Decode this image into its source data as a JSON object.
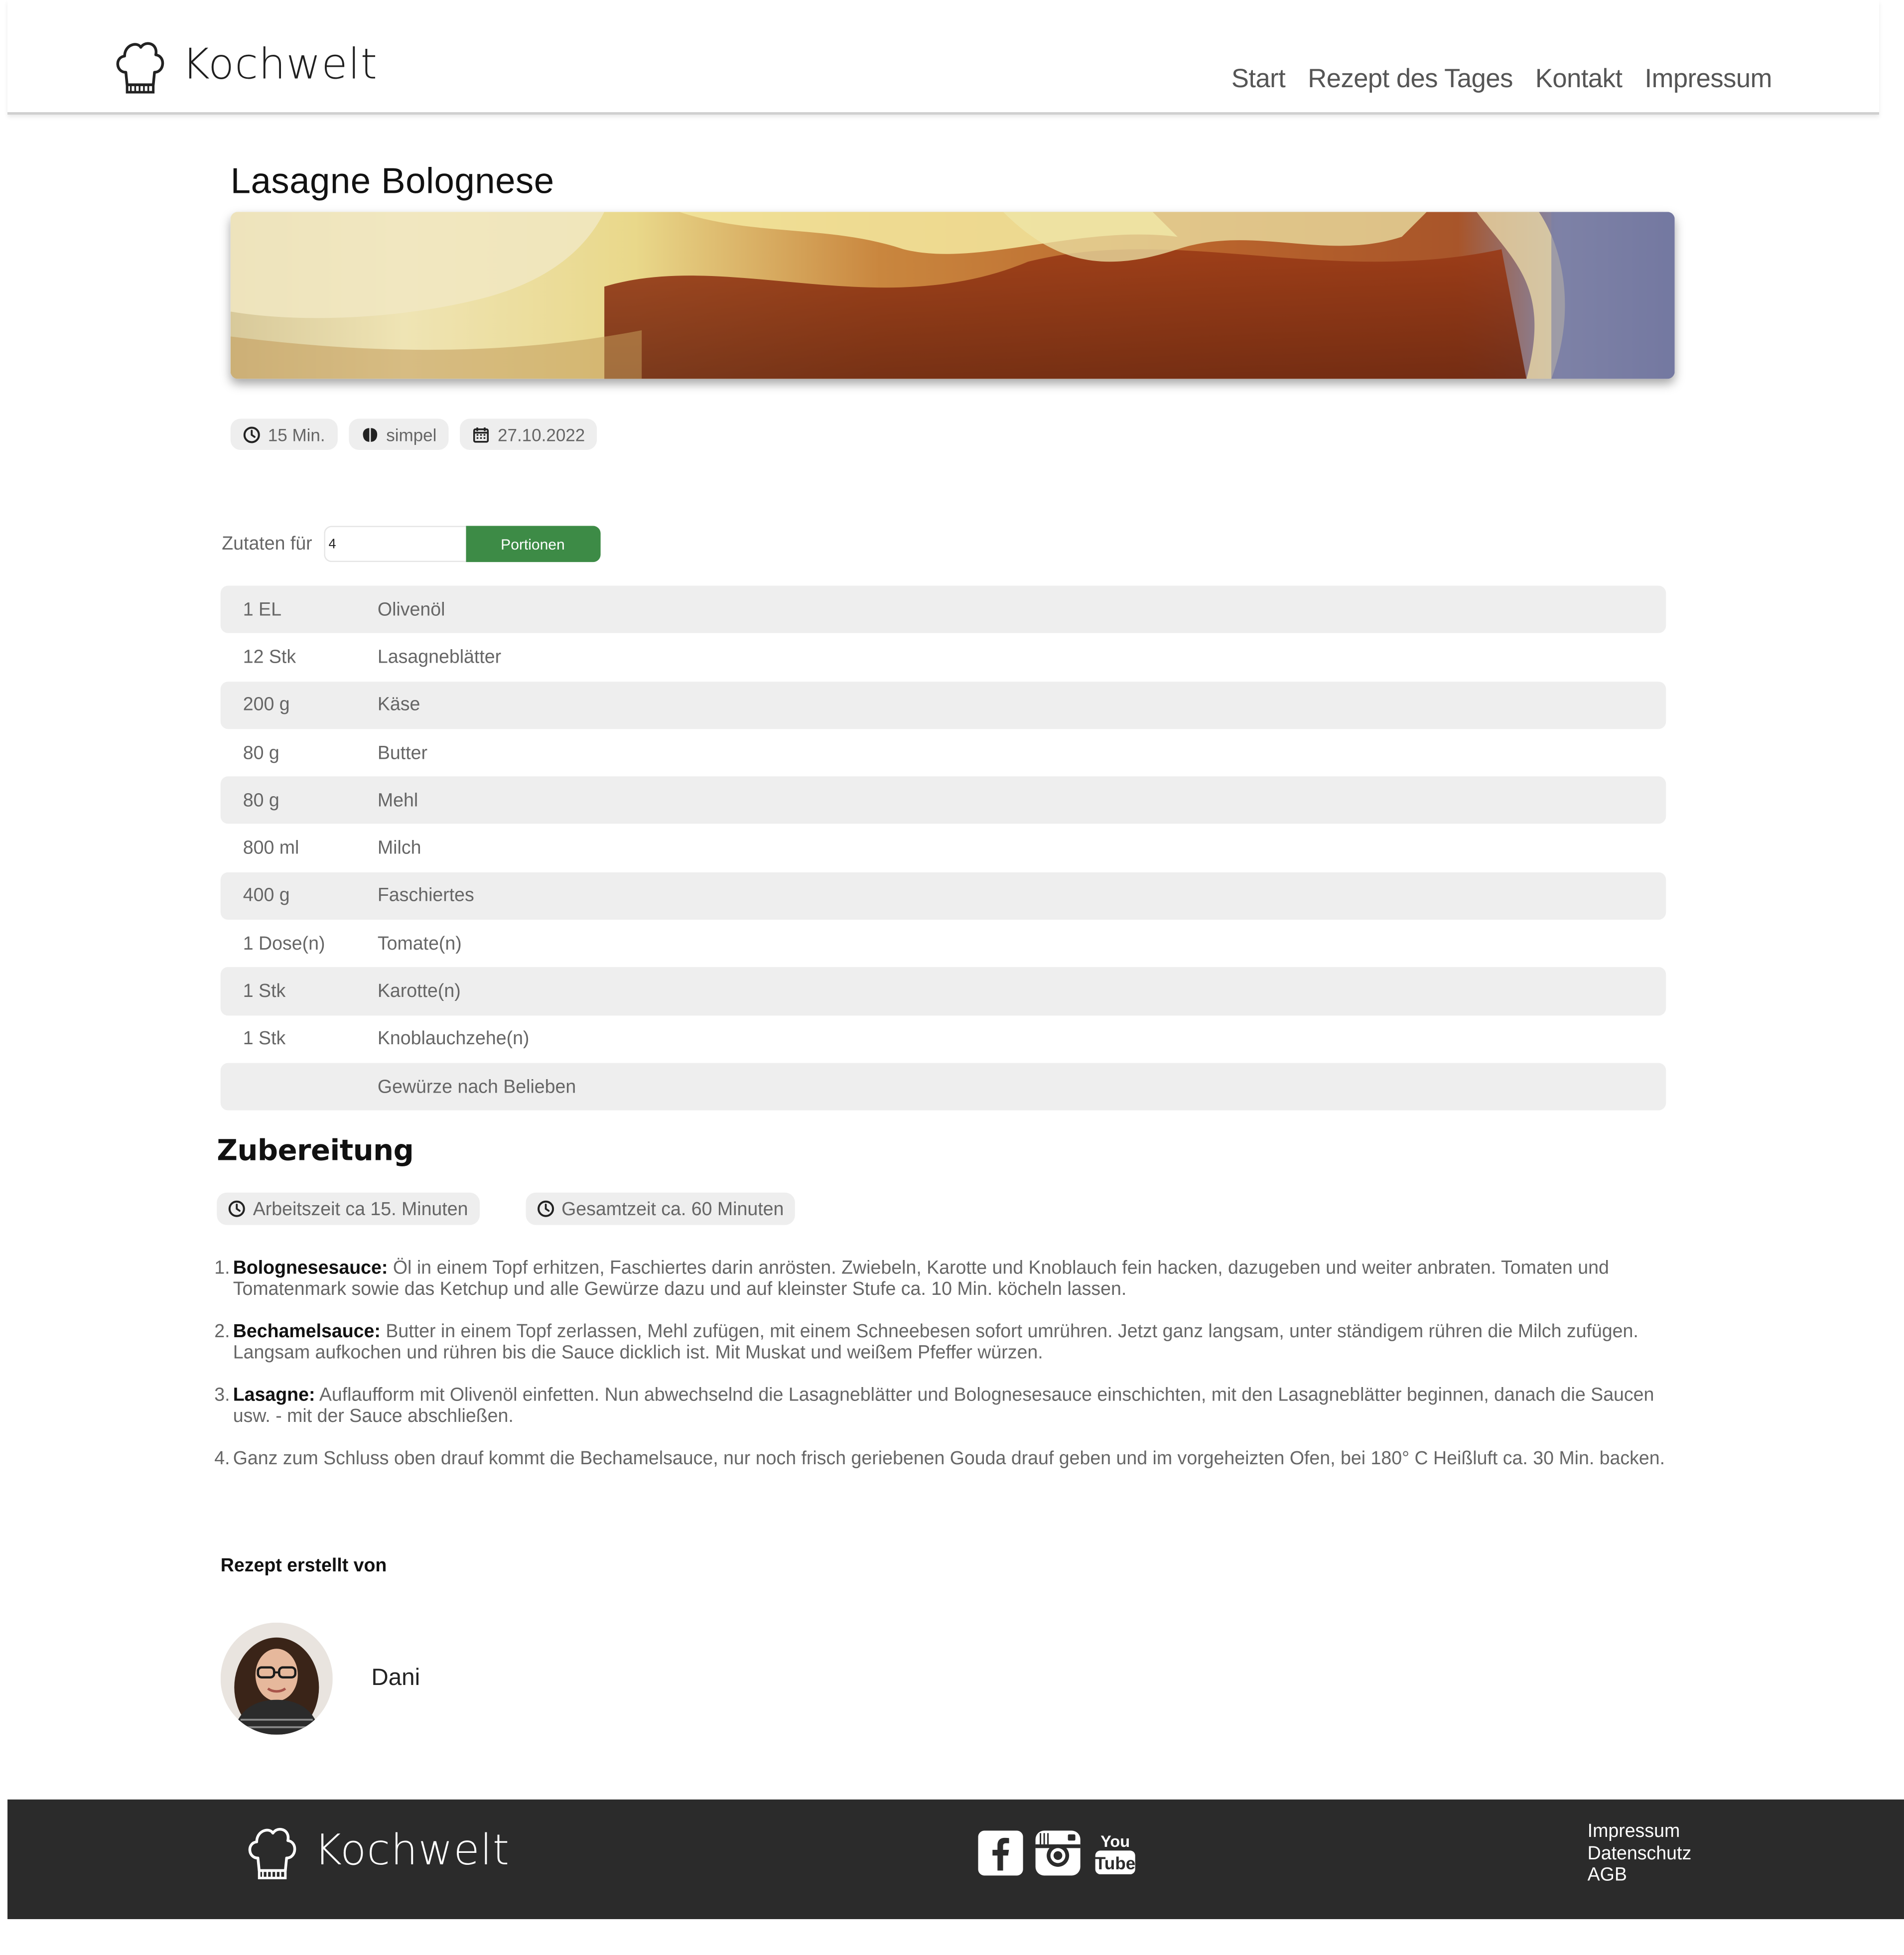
{
  "brand": {
    "name": "Kochwelt"
  },
  "nav": {
    "items": [
      {
        "label": "Start"
      },
      {
        "label": "Rezept des Tages"
      },
      {
        "label": "Kontakt"
      },
      {
        "label": "Impressum"
      }
    ]
  },
  "recipe": {
    "title": "Lasagne Bolognese",
    "meta": {
      "time": "15 Min.",
      "difficulty": "simpel",
      "date": "27.10.2022"
    },
    "portions": {
      "label": "Zutaten für",
      "value": "4",
      "button_label": "Portionen"
    },
    "ingredients": [
      {
        "amount": "1 EL",
        "name": "Olivenöl"
      },
      {
        "amount": "12 Stk",
        "name": "Lasagneblätter"
      },
      {
        "amount": "200 g",
        "name": "Käse"
      },
      {
        "amount": "80 g",
        "name": "Butter"
      },
      {
        "amount": "80 g",
        "name": "Mehl"
      },
      {
        "amount": "800 ml",
        "name": "Milch"
      },
      {
        "amount": "400 g",
        "name": "Faschiertes"
      },
      {
        "amount": "1 Dose(n)",
        "name": "Tomate(n)"
      },
      {
        "amount": "1 Stk",
        "name": "Karotte(n)"
      },
      {
        "amount": "1 Stk",
        "name": "Knoblauchzehe(n)"
      },
      {
        "amount": "",
        "name": "Gewürze nach Belieben"
      }
    ]
  },
  "preparation": {
    "title": "Zubereitung",
    "work_time": "Arbeitszeit ca 15. Minuten",
    "total_time": "Gesamtzeit ca. 60 Minuten",
    "steps": [
      {
        "num": "1.",
        "bold": "Bolognesesauce:",
        "text": " Öl in einem Topf erhitzen, Faschiertes darin anrösten. Zwiebeln, Karotte und Knoblauch fein hacken, dazugeben und weiter anbraten. Tomaten und Tomatenmark sowie das Ketchup und alle Gewürze dazu und auf kleinster Stufe ca. 10 Min. köcheln lassen."
      },
      {
        "num": "2.",
        "bold": "Bechamelsauce:",
        "text": " Butter in einem Topf zerlassen, Mehl zufügen, mit einem Schneebesen sofort umrühren. Jetzt ganz langsam, unter ständigem rühren die Milch zufügen. Langsam aufkochen und rühren bis die Sauce dicklich ist. Mit Muskat und weißem Pfeffer würzen."
      },
      {
        "num": "3.",
        "bold": "Lasagne:",
        "text": " Auflaufform mit Olivenöl einfetten. Nun abwechselnd die Lasagneblätter und Bolognesesauce einschichten, mit den Lasagneblätter beginnen, danach die Saucen usw. - mit der Sauce abschließen."
      },
      {
        "num": "4.",
        "bold": "",
        "text": "Ganz zum Schluss oben drauf kommt die Bechamelsauce, nur noch frisch geriebenen Gouda drauf geben und im vorgeheizten Ofen, bei 180° C Heißluft ca. 30 Min. backen."
      }
    ]
  },
  "author": {
    "label": "Rezept erstellt von",
    "name": "Dani"
  },
  "footer": {
    "brand": "Kochwelt",
    "social": [
      "facebook-icon",
      "instagram-icon",
      "youtube-icon"
    ],
    "links": [
      {
        "label": "Impressum"
      },
      {
        "label": "Datenschutz"
      },
      {
        "label": "AGB"
      }
    ]
  },
  "colors": {
    "accent_green": "#3d8b46",
    "pill_bg": "#eeeeee",
    "footer_bg": "#2b2b2b"
  }
}
